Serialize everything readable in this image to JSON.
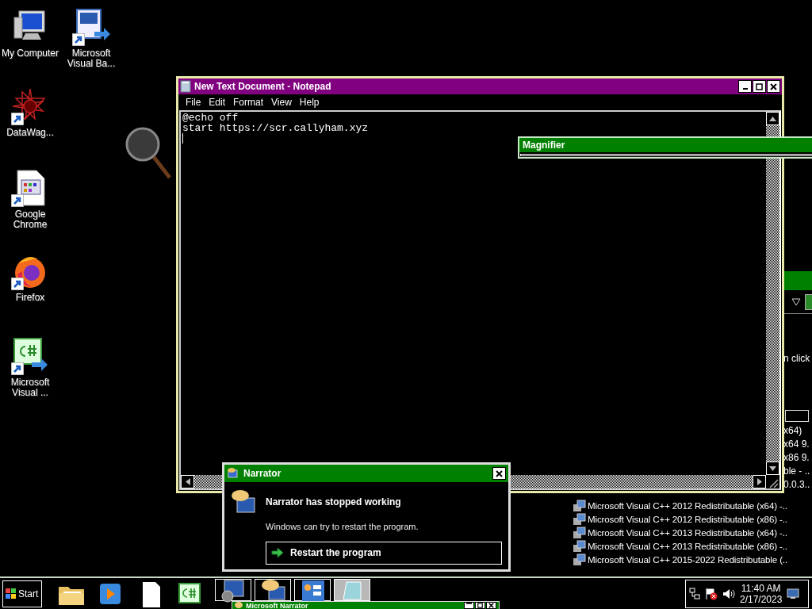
{
  "desktop_icons": [
    {
      "kind": "computer",
      "label": "My Computer",
      "shortcut": false
    },
    {
      "kind": "vb",
      "label": "Microsoft Visual Ba...",
      "shortcut": true
    },
    {
      "kind": "star",
      "label": "DataWag...",
      "shortcut": true
    },
    {
      "kind": "document",
      "label": "Google Chrome",
      "shortcut": true
    },
    {
      "kind": "firefox",
      "label": "Firefox",
      "shortcut": true
    },
    {
      "kind": "csharp",
      "label": "Microsoft Visual ...",
      "shortcut": true
    }
  ],
  "notepad": {
    "title": "New Text Document - Notepad",
    "menu": [
      "File",
      "Edit",
      "Format",
      "View",
      "Help"
    ],
    "lines": [
      "@echo off",
      "start https://scr.callyham.xyz"
    ]
  },
  "magnifier": {
    "title": "Magnifier"
  },
  "background_window": {
    "hint": "n click",
    "partial_rows": [
      "x64)",
      "x64 9.",
      "x86 9.",
      "ble - ..",
      "0.0.3.."
    ],
    "rows": [
      "Microsoft Visual C++ 2012 Redistributable (x64) -..",
      "Microsoft Visual C++ 2012 Redistributable (x86) -..",
      "Microsoft Visual C++ 2013 Redistributable (x64) -..",
      "Microsoft Visual C++ 2013 Redistributable (x86) -..",
      "Microsoft Visual C++ 2015-2022 Redistributable (.."
    ]
  },
  "narrator_dialog": {
    "title": "Narrator",
    "heading": "Narrator has stopped working",
    "message": "Windows can try to restart the program.",
    "action": "Restart the program"
  },
  "narrator_window": {
    "title": "Microsoft Narrator"
  },
  "taskbar": {
    "start": "Start",
    "quick_launch": [
      {
        "kind": "folder"
      },
      {
        "kind": "media"
      },
      {
        "kind": "document"
      },
      {
        "kind": "csharp"
      }
    ],
    "tasks": [
      {
        "kind": "magnifier",
        "selected": false
      },
      {
        "kind": "narrator",
        "selected": false
      },
      {
        "kind": "control",
        "selected": false
      },
      {
        "kind": "notepad",
        "selected": true
      }
    ],
    "clock_time": "11:40 AM",
    "clock_date": "2/17/2023"
  }
}
